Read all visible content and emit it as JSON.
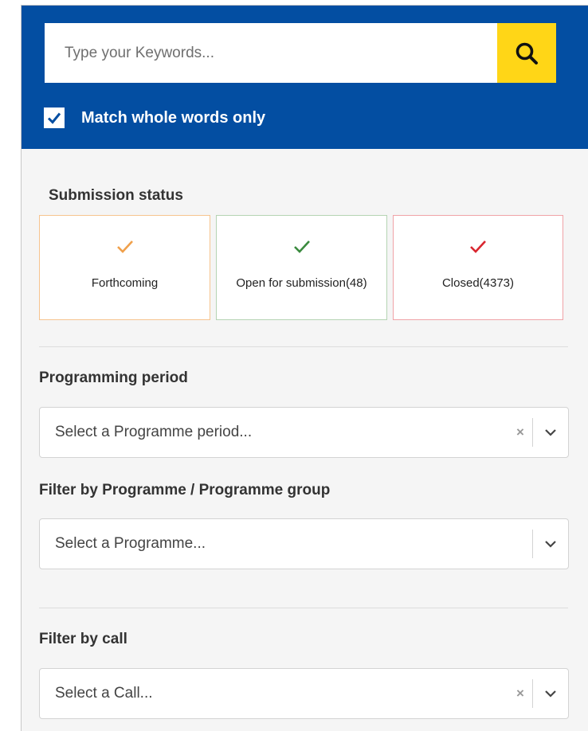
{
  "search": {
    "placeholder": "Type your Keywords...",
    "match_whole_words_label": "Match whole words only",
    "match_whole_words_checked": true
  },
  "submission_status": {
    "title": "Submission status",
    "options": [
      {
        "label": "Forthcoming",
        "color": "#f0a04b"
      },
      {
        "label": "Open for submission(48)",
        "color": "#3a8a3e"
      },
      {
        "label": "Closed(4373)",
        "color": "#d9262f"
      }
    ]
  },
  "programming_period": {
    "title": "Programming period",
    "placeholder": "Select a Programme period...",
    "clear_symbol": "×"
  },
  "programme_filter": {
    "title": "Filter by Programme / Programme group",
    "placeholder": "Select a Programme..."
  },
  "call_filter": {
    "title": "Filter by call",
    "placeholder": "Select a Call...",
    "clear_symbol": "×"
  },
  "colors": {
    "header_blue": "#034ea2",
    "search_button_yellow": "#ffd617",
    "panel_bg": "#f5f5f5"
  },
  "icons": {
    "search_button": "search-icon",
    "checkbox": "checkmark-icon",
    "dropdown": "chevron-down-icon",
    "clear": "clear-icon"
  }
}
